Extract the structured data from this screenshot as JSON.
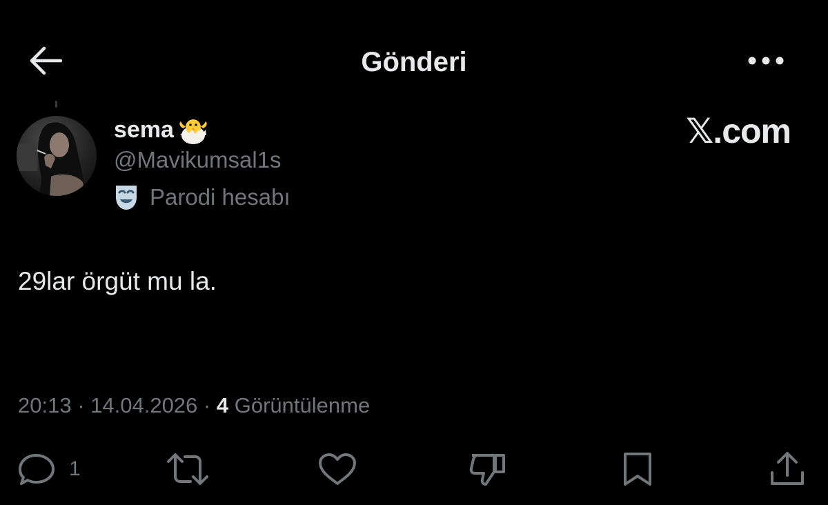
{
  "header": {
    "title": "Gönderi",
    "back_icon": "arrow-left-icon",
    "more_icon": "more-horizontal-icon"
  },
  "post": {
    "author": {
      "name": "sema",
      "name_emoji": "hatching-chick-emoji-icon",
      "handle": "@Mavikumsal1s",
      "parody_label": "Parodi hesabı",
      "parody_icon": "theater-mask-icon"
    },
    "watermark": "𝕏.com",
    "text": "29lar örgüt mu la.",
    "time": "20:13",
    "separator": " · ",
    "date": "14.04.2026",
    "views_count": "4",
    "views_label": "Görüntülenme",
    "actions": {
      "reply_count": "1"
    }
  },
  "colors": {
    "background": "#000000",
    "text_primary": "#e7e9ea",
    "text_secondary": "#71767b"
  }
}
